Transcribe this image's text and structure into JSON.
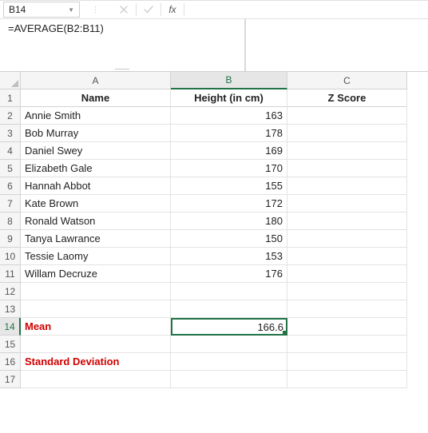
{
  "namebox": {
    "ref": "B14"
  },
  "formula_bar": {
    "formula": "=AVERAGE(B2:B11)",
    "fx_label": "fx"
  },
  "columns": {
    "A": "A",
    "B": "B",
    "C": "C"
  },
  "rows": [
    "1",
    "2",
    "3",
    "4",
    "5",
    "6",
    "7",
    "8",
    "9",
    "10",
    "11",
    "12",
    "13",
    "14",
    "15",
    "16",
    "17"
  ],
  "headers": {
    "name": "Name",
    "height": "Height (in cm)",
    "zscore": "Z Score"
  },
  "data_rows": [
    {
      "name": "Annie Smith",
      "height": "163"
    },
    {
      "name": "Bob Murray",
      "height": "178"
    },
    {
      "name": "Daniel Swey",
      "height": "169"
    },
    {
      "name": "Elizabeth Gale",
      "height": "170"
    },
    {
      "name": "Hannah Abbot",
      "height": "155"
    },
    {
      "name": "Kate Brown",
      "height": "172"
    },
    {
      "name": "Ronald Watson",
      "height": "180"
    },
    {
      "name": "Tanya Lawrance",
      "height": "150"
    },
    {
      "name": "Tessie Laomy",
      "height": "153"
    },
    {
      "name": "Willam Decruze",
      "height": "176"
    }
  ],
  "stats": {
    "mean_label": "Mean",
    "mean_value": "166.6",
    "sd_label": "Standard Deviation"
  },
  "active_cell": "B14",
  "chart_data": {
    "type": "table",
    "title": "",
    "columns": [
      "Name",
      "Height (in cm)",
      "Z Score"
    ],
    "rows": [
      [
        "Annie Smith",
        163,
        null
      ],
      [
        "Bob Murray",
        178,
        null
      ],
      [
        "Daniel Swey",
        169,
        null
      ],
      [
        "Elizabeth Gale",
        170,
        null
      ],
      [
        "Hannah Abbot",
        155,
        null
      ],
      [
        "Kate Brown",
        172,
        null
      ],
      [
        "Ronald Watson",
        180,
        null
      ],
      [
        "Tanya Lawrance",
        150,
        null
      ],
      [
        "Tessie Laomy",
        153,
        null
      ],
      [
        "Willam Decruze",
        176,
        null
      ]
    ],
    "summary": {
      "Mean": 166.6,
      "Standard Deviation": null
    }
  }
}
